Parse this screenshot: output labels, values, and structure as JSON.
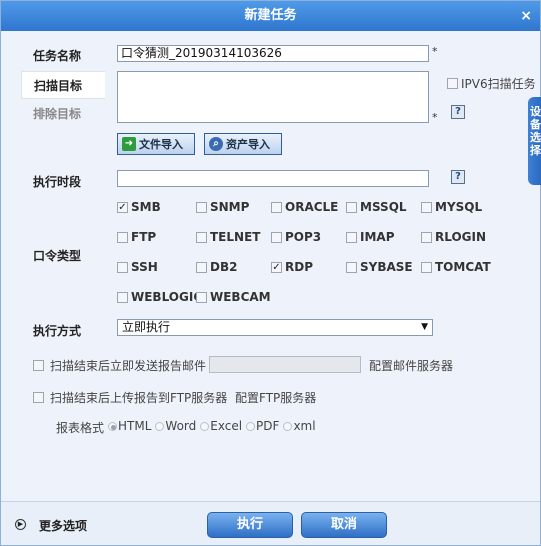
{
  "dialog": {
    "title": "新建任务",
    "close": "×"
  },
  "task_name": {
    "label": "任务名称",
    "value": "口令猜测_20190314103626",
    "required": "*"
  },
  "targets": {
    "scan_tab": "扫描目标",
    "exclude_tab": "排除目标",
    "required": "*",
    "ipv6_label": "IPV6扫描任务",
    "help": "?"
  },
  "import_buttons": {
    "file_import": "文件导入",
    "asset_import": "资产导入"
  },
  "exec_period": {
    "label": "执行时段",
    "value": "",
    "help": "?"
  },
  "password_type": {
    "label": "口令类型",
    "options": [
      {
        "label": "SMB",
        "checked": true
      },
      {
        "label": "SNMP",
        "checked": false
      },
      {
        "label": "ORACLE",
        "checked": false
      },
      {
        "label": "MSSQL",
        "checked": false
      },
      {
        "label": "MYSQL",
        "checked": false
      },
      {
        "label": "FTP",
        "checked": false
      },
      {
        "label": "TELNET",
        "checked": false
      },
      {
        "label": "POP3",
        "checked": false
      },
      {
        "label": "IMAP",
        "checked": false
      },
      {
        "label": "RLOGIN",
        "checked": false
      },
      {
        "label": "SSH",
        "checked": false
      },
      {
        "label": "DB2",
        "checked": false
      },
      {
        "label": "RDP",
        "checked": true
      },
      {
        "label": "SYBASE",
        "checked": false
      },
      {
        "label": "TOMCAT",
        "checked": false
      },
      {
        "label": "WEBLOGIC",
        "checked": false
      },
      {
        "label": "WEBCAM",
        "checked": false
      }
    ]
  },
  "exec_mode": {
    "label": "执行方式",
    "selected": "立即执行",
    "arrow": "▼"
  },
  "email_report": {
    "label": "扫描结束后立即发送报告邮件",
    "value": "",
    "config_link": "配置邮件服务器"
  },
  "ftp_report": {
    "label": "扫描结束后上传报告到FTP服务器",
    "config_link": "配置FTP服务器"
  },
  "report_format": {
    "label": "报表格式",
    "options": [
      {
        "label": "HTML",
        "selected": true
      },
      {
        "label": "Word",
        "selected": false
      },
      {
        "label": "Excel",
        "selected": false
      },
      {
        "label": "PDF",
        "selected": false
      },
      {
        "label": "xml",
        "selected": false
      }
    ]
  },
  "footer": {
    "more_options": "更多选项",
    "execute": "执行",
    "cancel": "取消"
  },
  "side_panel": {
    "text": "设备选择"
  },
  "icons": {
    "check": "✓",
    "more": "▶"
  },
  "colors": {
    "title_bar": "#2f76cf",
    "background": "#eef3fb",
    "button": "#2e6fc6"
  }
}
